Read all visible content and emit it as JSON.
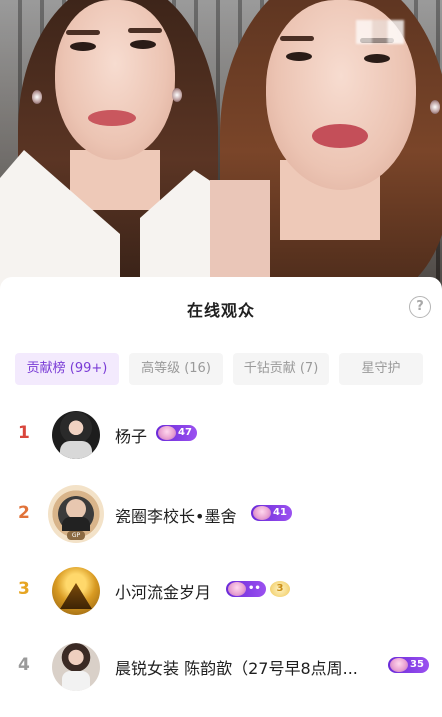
{
  "panel": {
    "title": "在线观众",
    "help_icon": "?"
  },
  "tabs": [
    {
      "label": "贡献榜 (99+)",
      "active": true
    },
    {
      "label": "高等级 (16)",
      "active": false
    },
    {
      "label": "千钻贡献 (7)",
      "active": false
    },
    {
      "label": "星守护",
      "active": false
    }
  ],
  "viewers": [
    {
      "rank": "1",
      "name": "杨子",
      "badge_level": "47",
      "rank_color": "#d9463c",
      "avatar_icon": "user-avatar-icon"
    },
    {
      "rank": "2",
      "name": "瓷圈李校长•墨舍",
      "badge_level": "41",
      "rank_color": "#e1733a",
      "avatar_icon": "user-avatar-icon",
      "avatar_frame_label": "GP"
    },
    {
      "rank": "3",
      "name": "小河流金岁月",
      "badge_level": "••",
      "fan_badge": "3",
      "rank_color": "#e6a523",
      "avatar_icon": "user-avatar-icon"
    },
    {
      "rank": "4",
      "name": "晨锐女装 陈韵歆（27号早8点周...",
      "badge_level": "35",
      "rank_color": "#9a9a9a",
      "avatar_icon": "user-avatar-icon"
    }
  ],
  "colors": {
    "accent": "#7a3cd6",
    "badge_purple": "#6a2ad8"
  }
}
